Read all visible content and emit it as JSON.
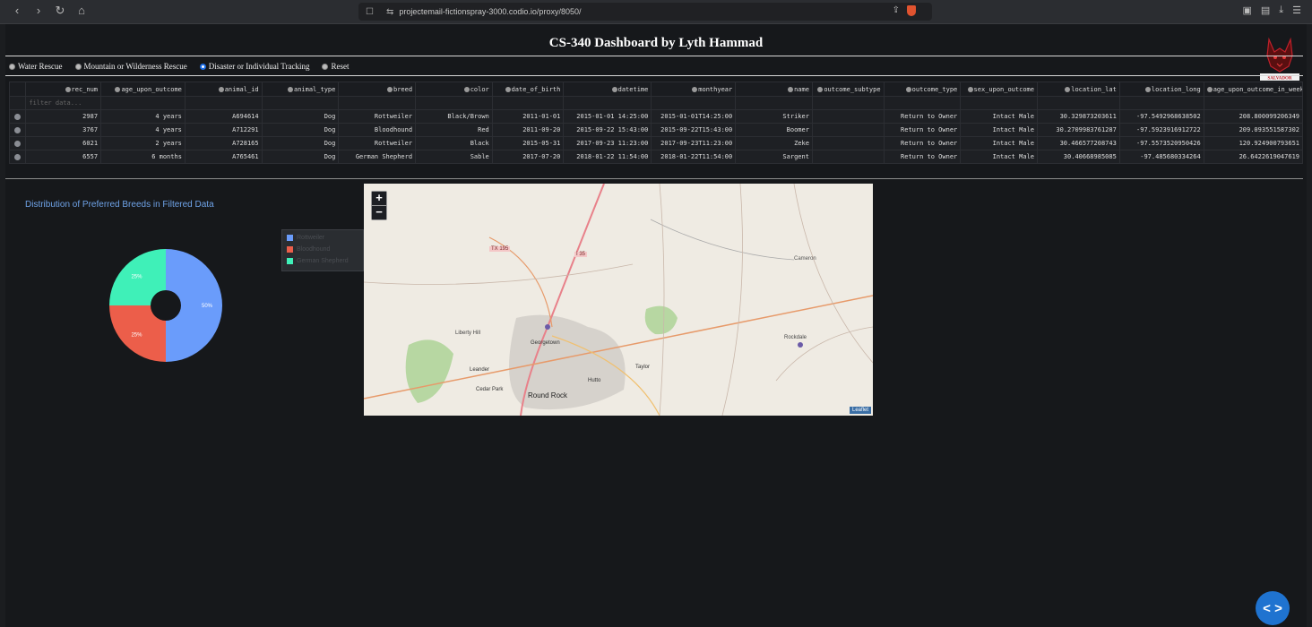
{
  "browser": {
    "url": "projectemail-fictionspray-3000.codio.io/proxy/8050/"
  },
  "dashboard": {
    "title": "CS-340 Dashboard by Lyth Hammad",
    "logo_text": "SALVADOR"
  },
  "filters": {
    "options": [
      "Water Rescue",
      "Mountain or Wilderness Rescue",
      "Disaster or Individual Tracking",
      "Reset"
    ],
    "selected": "Disaster or Individual Tracking"
  },
  "table": {
    "columns": [
      "rec_num",
      "age_upon_outcome",
      "animal_id",
      "animal_type",
      "breed",
      "color",
      "date_of_birth",
      "datetime",
      "monthyear",
      "name",
      "outcome_subtype",
      "outcome_type",
      "sex_upon_outcome",
      "location_lat",
      "location_long",
      "age_upon_outcome_in_weeks"
    ],
    "filter_placeholder": "filter data...",
    "rows": [
      [
        "2987",
        "4 years",
        "A694614",
        "Dog",
        "Rottweiler",
        "Black/Brown",
        "2011-01-01",
        "2015-01-01 14:25:00",
        "2015-01-01T14:25:00",
        "Striker",
        "",
        "Return to Owner",
        "Intact Male",
        "30.329873203611",
        "-97.5492968638502",
        "208.800099206349"
      ],
      [
        "3767",
        "4 years",
        "A712291",
        "Dog",
        "Bloodhound",
        "Red",
        "2011-09-20",
        "2015-09-22 15:43:00",
        "2015-09-22T15:43:00",
        "Boomer",
        "",
        "Return to Owner",
        "Intact Male",
        "30.2709983761287",
        "-97.5923916912722",
        "209.093551587302"
      ],
      [
        "6021",
        "2 years",
        "A728165",
        "Dog",
        "Rottweiler",
        "Black",
        "2015-05-31",
        "2017-09-23 11:23:00",
        "2017-09-23T11:23:00",
        "Zeke",
        "",
        "Return to Owner",
        "Intact Male",
        "30.466577208743",
        "-97.5573520950426",
        "120.924900793651"
      ],
      [
        "6557",
        "6 months",
        "A765461",
        "Dog",
        "German Shepherd",
        "Sable",
        "2017-07-20",
        "2018-01-22 11:54:00",
        "2018-01-22T11:54:00",
        "Sargent",
        "",
        "Return to Owner",
        "Intact Male",
        "30.40668985085",
        "-97.485680334264",
        "26.6422619047619"
      ]
    ]
  },
  "pie": {
    "title": "Distribution of Preferred Breeds in Filtered Data"
  },
  "chart_data": {
    "type": "pie",
    "title": "Distribution of Preferred Breeds in Filtered Data",
    "hole": true,
    "series": [
      {
        "label": "Rottweiler",
        "value": 50,
        "color": "#6a9cfb",
        "pct_label": "50%"
      },
      {
        "label": "Bloodhound",
        "value": 25,
        "color": "#ec5e4a",
        "pct_label": "25%"
      },
      {
        "label": "German Shepherd",
        "value": 25,
        "color": "#3ff0b8",
        "pct_label": "25%"
      }
    ],
    "legend_position": "right"
  },
  "map": {
    "places": [
      "TX 195",
      "I 35",
      "Cameron",
      "Liberty Hill",
      "Georgetown",
      "Leander",
      "Taylor",
      "Hutto",
      "Cedar Park",
      "Round Rock",
      "Rockdale"
    ],
    "zoom_in": "+",
    "zoom_out": "−",
    "attribution": "Leaflet"
  },
  "fab": {
    "label": "< >"
  }
}
